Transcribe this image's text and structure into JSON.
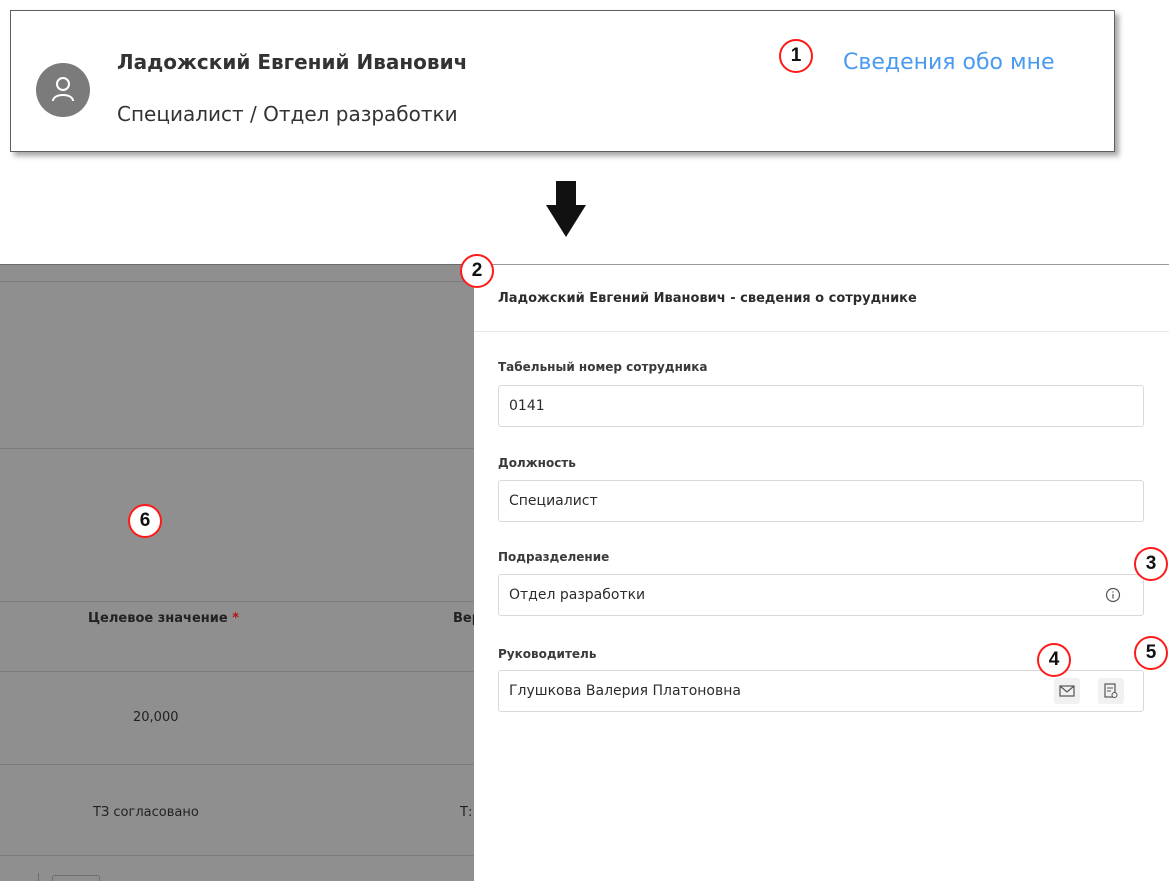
{
  "profile": {
    "name": "Ладожский Евгений Иванович",
    "role": "Специалист / Отдел разработки",
    "about_link": "Сведения обо мне",
    "avatar_icon": "user-icon"
  },
  "callouts": [
    "1",
    "2",
    "3",
    "4",
    "5",
    "6"
  ],
  "background_table": {
    "headers": [
      "Целевое значение",
      "Вер"
    ],
    "required_mark": "*",
    "rows": [
      [
        "20,000",
        ""
      ],
      [
        "ТЗ согласовано",
        "Т:"
      ]
    ]
  },
  "panel": {
    "title": "Ладожский Евгений Иванович - сведения о сотруднике",
    "fields": [
      {
        "label": "Табельный номер сотрудника",
        "value": "0141"
      },
      {
        "label": "Должность",
        "value": "Специалист"
      },
      {
        "label": "Подразделение",
        "value": "Отдел разработки",
        "icon": "info-icon"
      },
      {
        "label": "Руководитель",
        "value": "Глушкова Валерия Платоновна",
        "icons": [
          "mail-icon",
          "document-icon"
        ]
      }
    ]
  },
  "colors": {
    "link": "#4a9af0",
    "callout_border": "#ff1a1a",
    "overlay": "#8f8f8f",
    "required": "#b31414"
  }
}
